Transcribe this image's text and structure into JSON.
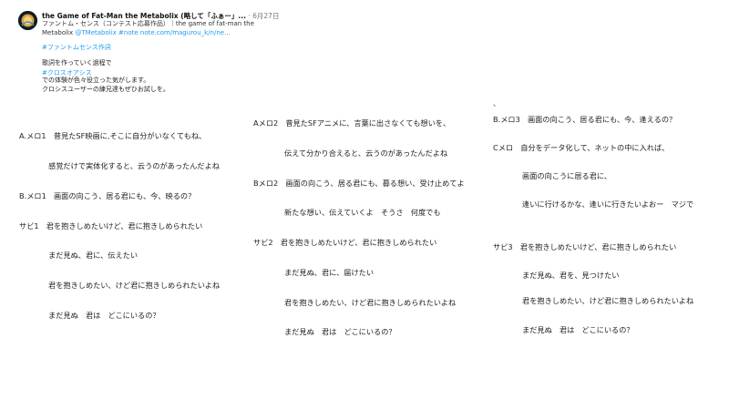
{
  "post": {
    "author": "the Game of Fat-Man the Metabolix (略して「ふぁー」...",
    "separator": " · ",
    "date": "6月27日",
    "title_line1_plain": "ファントム・センス（コンテスト応募作品）｜the game of fat-man the",
    "title_line2_plain": "Metabolix ",
    "title_line2_handle": "@TMetabolix",
    "title_line2_tag": " #note",
    "title_line2_url": " note.com/magurou_k/n/ne...",
    "hashtag1": "#ファントムセンス作詞",
    "desc_line1": "歌詞を作っていく過程で",
    "hashtag2": "#クロスオアシス",
    "desc_line2": "での体験が色々役立った気がします。",
    "desc_line3": "クロシスユーザーの練兄達もぜひお試しを。"
  },
  "lyrics": {
    "col1": [
      "A.メロ1　昔見たSF映画に,そこに自分がいなくてもね、",
      "感覚だけで実体化すると、云うのがあったんだよね",
      "B.メロ1　画面の向こう、居る君にも、今、映るの？",
      "サビ1　君を抱きしめたいけど、君に抱きしめられたい",
      "まだ見ぬ、君に、伝えたい",
      "君を抱きしめたい、けど君に抱きしめられたいよね",
      "まだ見ぬ　君は　どこにいるの？"
    ],
    "col2": [
      "Aメロ2　昔見たSFアニメに、言葉に出さなくても想いを、",
      "伝えて分かり合えると、云うのがあったんだよね",
      "Bメロ2　画面の向こう、居る君にも、募る想い、受け止めてよ",
      "新たな想い、伝えていくよ　そうさ　何度でも",
      "サビ2　君を抱きしめたいけど、君に抱きしめられたい",
      "まだ見ぬ、君に、届けたい",
      "君を抱きしめたい、けど君に抱きしめられたいよね",
      "まだ見ぬ　君は　どこにいるの？"
    ],
    "col3_dot": "、",
    "col3": [
      "B.メロ3　画面の向こう、居る君にも、今、逢えるの？",
      "Cメロ　自分をデータ化して、ネットの中に入れば、",
      "画面の向こうに居る君に、",
      "逢いに行けるかな、逢いに行きたいよおー　マジで",
      "サビ3　君を抱きしめたいけど、君に抱きしめられたい",
      "まだ見ぬ、君を、見つけたい",
      "君を抱きしめたい、けど君に抱きしめられたいよね",
      "まだ見ぬ　君は　どこにいるの？"
    ]
  },
  "icons": {
    "avatar": "profile-avatar"
  },
  "colors": {
    "link": "#1d9bf0",
    "text": "#222222",
    "muted": "#777777"
  }
}
